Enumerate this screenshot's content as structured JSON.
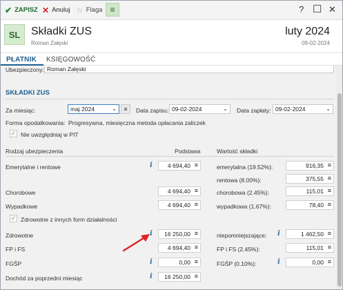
{
  "toolbar": {
    "save": "ZAPISZ",
    "cancel": "Anuluj",
    "flag": "Flaga",
    "menu_icon": "≡",
    "help": "?",
    "maximize": "☐",
    "close": "✕"
  },
  "header": {
    "avatar": "SL",
    "title": "Składki ZUS",
    "subtitle": "Roman Załęski",
    "period": "luty 2024",
    "date": "09-02-2024"
  },
  "tabs": [
    {
      "label": "PŁATNIK"
    },
    {
      "label": "KSIĘGOWOŚĆ"
    }
  ],
  "insured": {
    "label": "Ubezpieczony:",
    "value": "Roman Załęski"
  },
  "section": {
    "title": "SKŁADKI ZUS"
  },
  "form": {
    "month_label": "Za miesiąc:",
    "month_value": "maj 2024",
    "save_date_label": "Data zapisu:",
    "save_date_value": "09-02-2024",
    "pay_date_label": "Data zapłaty:",
    "pay_date_value": "09-02-2024",
    "tax_form_label": "Forma opodatkowania:",
    "tax_form_value": "Progresywna, miesięczna metoda opłacania zaliczek",
    "not_in_pit_label": "Nie uwzględniaj w PIT"
  },
  "columns": {
    "type": "Rodzaj ubezpieczenia",
    "base": "Podstawa",
    "value": "Wartość składki"
  },
  "rows": {
    "emerytalne": {
      "label": "Emerytalne i rentowe",
      "base": "4 694,40"
    },
    "emerytalna": {
      "label": "emerytalna (19.52%):",
      "value": "916,35"
    },
    "rentowa": {
      "label": "rentowa (8.00%):",
      "value": "375,55"
    },
    "chorobowe": {
      "label": "Chorobowe",
      "base": "4 694,40"
    },
    "chorobowa": {
      "label": "chorobowa (2.45%):",
      "value": "115,01"
    },
    "wypadkowe": {
      "label": "Wypadkowe",
      "base": "4 694,40"
    },
    "wypadkowa": {
      "label": "wypadkowa (1.67%):",
      "value": "78,40"
    },
    "health_other_label": "Zdrowotne z innych form działalności",
    "zdrowotne": {
      "label": "Zdrowotne",
      "base": "16 250,00"
    },
    "niepomniejszajace": {
      "label": "niepomniejszające:",
      "value": "1 462,50"
    },
    "fp": {
      "label": "FP i FS",
      "base": "4 694,40"
    },
    "fp_value": {
      "label": "FP i FS (2.45%):",
      "value": "115,01"
    },
    "fgsp": {
      "label": "FGŚP",
      "base": "0,00"
    },
    "fgsp_value": {
      "label": "FGŚP (0.10%):",
      "value": "0,00"
    },
    "income": {
      "label": "Dochód za poprzedni miesiąc",
      "base": "16 250,00"
    }
  },
  "colors": {
    "accent_blue": "#1b5f8f",
    "save_green": "#1e6b2c",
    "cancel_red": "#d0202a",
    "annotation_arrow": "#e02020"
  },
  "icons": {
    "save": "checkmark-icon",
    "cancel": "x-icon",
    "flag": "star-icon",
    "info": "info-icon",
    "calculator": "equals-icon",
    "dropdown": "chevron-down-icon",
    "annotation": "red-arrow-icon"
  }
}
